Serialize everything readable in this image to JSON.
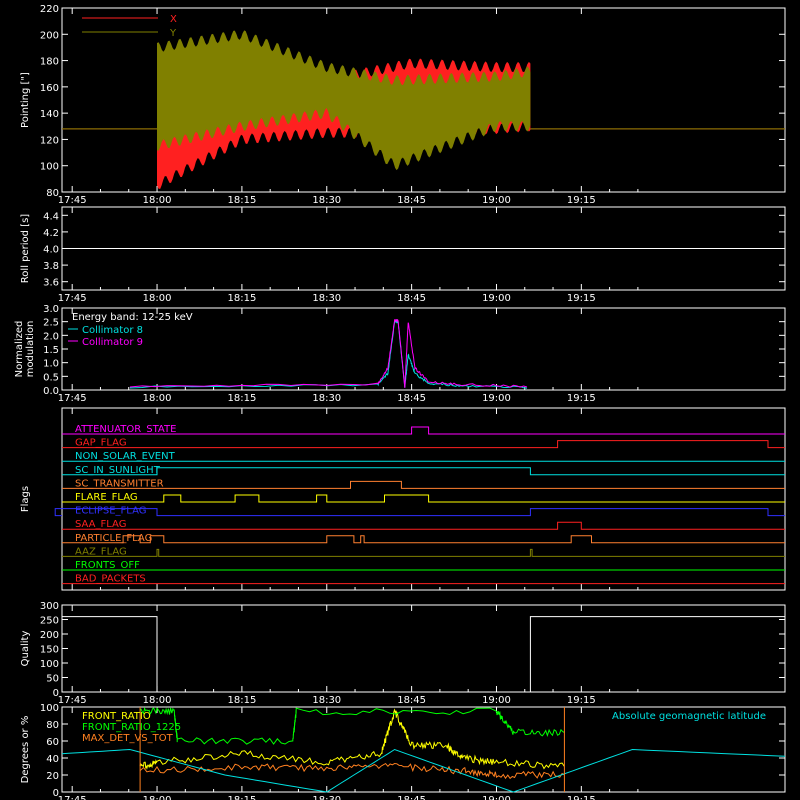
{
  "time_ticks": [
    "17:45",
    "18:00",
    "18:15",
    "18:30",
    "18:45",
    "19:00",
    "19:15"
  ],
  "time_values": [
    17.75,
    18.0,
    18.25,
    18.5,
    18.75,
    19.0,
    19.25
  ],
  "chart_data": [
    {
      "type": "line",
      "ylabel": "Pointing [\"]",
      "ylim": [
        80,
        220
      ],
      "yticks": [
        "80",
        "100",
        "120",
        "140",
        "160",
        "180",
        "200",
        "220"
      ],
      "legend": [
        {
          "name": "X",
          "color": "#ff2020"
        },
        {
          "name": "Y",
          "color": "#808000"
        }
      ],
      "series": [
        {
          "name": "X",
          "color": "#ff2020",
          "segments": [
            {
              "x": 18.0,
              "upper": 180,
              "lower": 85
            },
            {
              "x": 18.25,
              "upper": 170,
              "lower": 120
            },
            {
              "x": 18.5,
              "upper": 165,
              "lower": 125
            },
            {
              "x": 18.75,
              "upper": 178,
              "lower": 125
            },
            {
              "x": 19.0,
              "upper": 175,
              "lower": 128
            },
            {
              "x": 19.1,
              "upper": 175,
              "lower": 130
            }
          ],
          "baseline": 128
        },
        {
          "name": "Y",
          "color": "#808000",
          "segments": [
            {
              "x": 18.0,
              "upper": 190,
              "lower": 115
            },
            {
              "x": 18.25,
              "upper": 200,
              "lower": 130
            },
            {
              "x": 18.5,
              "upper": 175,
              "lower": 140
            },
            {
              "x": 18.7,
              "upper": 165,
              "lower": 100
            },
            {
              "x": 19.0,
              "upper": 168,
              "lower": 130
            },
            {
              "x": 19.1,
              "upper": 172,
              "lower": 130
            }
          ],
          "baseline": 128
        }
      ]
    },
    {
      "type": "line",
      "ylabel": "Roll period [s]",
      "ylim": [
        3.5,
        4.5
      ],
      "yticks": [
        "3.6",
        "3.8",
        "4.0",
        "4.2",
        "4.4"
      ],
      "series": [
        {
          "name": "",
          "color": "#ffffff",
          "values": [
            4.0,
            4.0
          ]
        }
      ]
    },
    {
      "type": "line",
      "ylabel": "Normalized modulation",
      "ylim": [
        0,
        3.0
      ],
      "yticks": [
        "0.0",
        "0.5",
        "1.0",
        "1.5",
        "2.0",
        "2.5",
        "3.0"
      ],
      "annotation": "Energy band: 12-25 keV",
      "legend": [
        {
          "name": "Collimator 8",
          "color": "#00e0e0"
        },
        {
          "name": "Collimator 9",
          "color": "#ff00ff"
        }
      ],
      "series": [
        {
          "name": "Collimator 8",
          "color": "#00e0e0",
          "x": [
            17.92,
            18.65,
            18.68,
            18.7,
            18.71,
            18.73,
            18.74,
            18.76,
            18.8,
            18.9,
            19.1
          ],
          "y": [
            0.1,
            0.2,
            0.6,
            2.5,
            2.5,
            0.1,
            1.3,
            0.6,
            0.25,
            0.15,
            0.1
          ]
        },
        {
          "name": "Collimator 9",
          "color": "#ff00ff",
          "x": [
            17.92,
            18.65,
            18.68,
            18.7,
            18.71,
            18.73,
            18.74,
            18.76,
            18.8,
            18.9,
            19.1
          ],
          "y": [
            0.12,
            0.22,
            0.8,
            2.55,
            2.55,
            0.1,
            2.5,
            0.8,
            0.3,
            0.2,
            0.12
          ]
        }
      ]
    },
    {
      "type": "line",
      "ylabel": "Flags",
      "flags": [
        {
          "name": "ATTENUATOR_STATE",
          "color": "#ff00ff",
          "on": [
            [
              18.75,
              18.8
            ]
          ]
        },
        {
          "name": "GAP_FLAG",
          "color": "#ff2020",
          "on": [
            [
              19.18,
              19.8
            ]
          ]
        },
        {
          "name": "NON_SOLAR_EVENT",
          "color": "#00e0e0",
          "on": []
        },
        {
          "name": "SC_IN_SUNLIGHT",
          "color": "#00e0e0",
          "on": [
            [
              18.0,
              19.1
            ]
          ]
        },
        {
          "name": "SC_TRANSMITTER",
          "color": "#ff8030",
          "on": [
            [
              18.57,
              18.72
            ]
          ]
        },
        {
          "name": "FLARE_FLAG",
          "color": "#ffff00",
          "on": [
            [
              18.02,
              18.07
            ],
            [
              18.23,
              18.3
            ],
            [
              18.47,
              18.5
            ],
            [
              18.67,
              18.8
            ]
          ]
        },
        {
          "name": "ECLIPSE_FLAG",
          "color": "#3030ff",
          "on": [
            [
              17.7,
              18.0
            ],
            [
              19.1,
              19.8
            ]
          ]
        },
        {
          "name": "SAA_FLAG",
          "color": "#ff2020",
          "on": [
            [
              19.18,
              19.25
            ]
          ]
        },
        {
          "name": "PARTICLE_FLAG",
          "color": "#ff8030",
          "on": [
            [
              17.9,
              17.95
            ],
            [
              17.98,
              18.02
            ],
            [
              18.5,
              18.58
            ],
            [
              18.6,
              18.61
            ],
            [
              19.22,
              19.28
            ]
          ]
        },
        {
          "name": "AAZ_FLAG",
          "color": "#808000",
          "on": [
            [
              18.0,
              18.005
            ],
            [
              19.1,
              19.105
            ]
          ]
        },
        {
          "name": "FRONTS_OFF",
          "color": "#00ff00",
          "on": []
        },
        {
          "name": "BAD_PACKETS",
          "color": "#ff2020",
          "on": []
        }
      ]
    },
    {
      "type": "line",
      "ylabel": "Quality",
      "ylim": [
        0,
        300
      ],
      "yticks": [
        "0",
        "50",
        "100",
        "150",
        "200",
        "250",
        "300"
      ],
      "series": [
        {
          "name": "",
          "color": "#ffffff",
          "x": [
            17.72,
            18.0,
            18.0,
            19.1,
            19.1,
            19.85
          ],
          "y": [
            260,
            260,
            0,
            0,
            260,
            260
          ]
        }
      ]
    },
    {
      "type": "line",
      "ylabel": "Degrees or %",
      "ylim": [
        0,
        100
      ],
      "yticks": [
        "0",
        "20",
        "40",
        "60",
        "80",
        "100"
      ],
      "legend": [
        {
          "name": "FRONT_RATIO",
          "color": "#ffff00"
        },
        {
          "name": "FRONT_RATIO_1225",
          "color": "#00ff00"
        },
        {
          "name": "MAX_DET_VS_TOT",
          "color": "#ff8020"
        }
      ],
      "legend_right": {
        "name": "Absolute geomagnetic latitude",
        "color": "#00e0e0"
      },
      "series": [
        {
          "name": "FRONT_RATIO",
          "color": "#ffff00",
          "x": [
            17.95,
            18.0,
            18.25,
            18.5,
            18.66,
            18.7,
            18.75,
            18.85,
            18.9,
            19.0,
            19.2
          ],
          "y": [
            30,
            35,
            45,
            35,
            45,
            95,
            55,
            55,
            40,
            35,
            30
          ]
        },
        {
          "name": "FRONT_RATIO_1225",
          "color": "#00ff00",
          "x": [
            17.95,
            18.05,
            18.06,
            18.4,
            18.41,
            19.0,
            19.05,
            19.2
          ],
          "y": [
            95,
            95,
            60,
            60,
            95,
            95,
            70,
            70
          ]
        },
        {
          "name": "MAX_DET_VS_TOT",
          "color": "#ff8020",
          "x": [
            17.95,
            18.25,
            18.5,
            18.7,
            18.9,
            19.0,
            19.2
          ],
          "y": [
            25,
            30,
            28,
            30,
            25,
            20,
            20
          ]
        },
        {
          "name": "Absolute geomagnetic latitude",
          "color": "#00e0e0",
          "x": [
            17.72,
            17.92,
            18.2,
            18.5,
            18.7,
            19.05,
            19.4,
            19.85
          ],
          "y": [
            45,
            50,
            20,
            0,
            50,
            0,
            50,
            42
          ]
        }
      ]
    }
  ]
}
